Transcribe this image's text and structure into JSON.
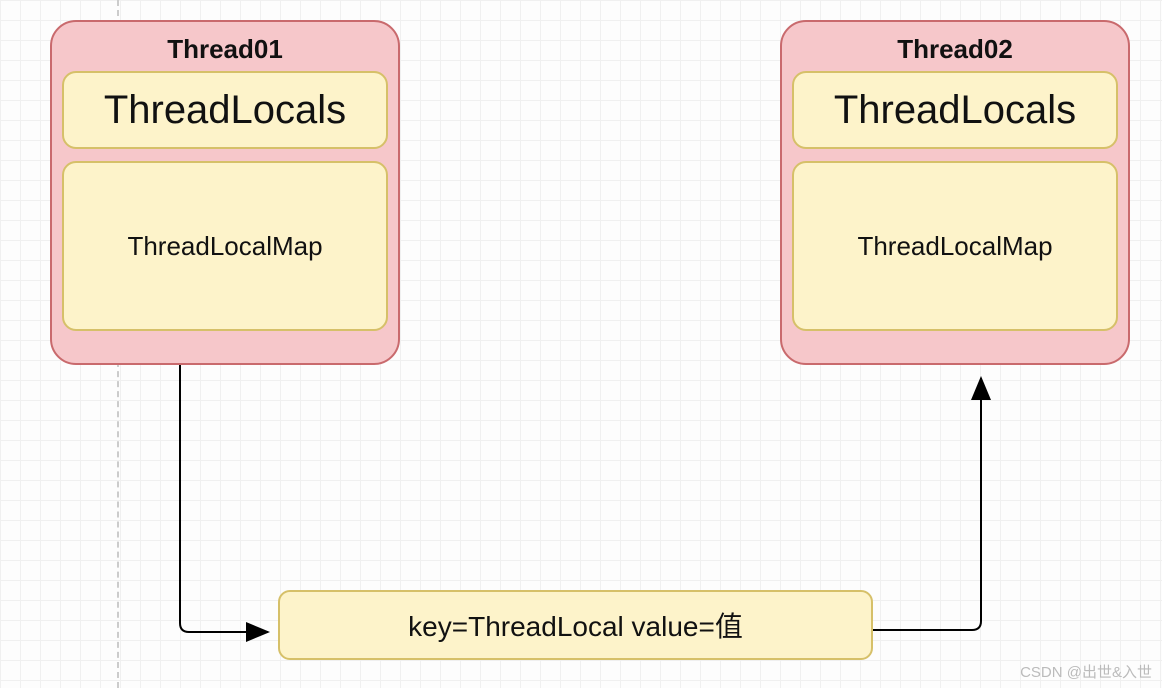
{
  "thread1": {
    "title": "Thread01",
    "locals": "ThreadLocals",
    "map": "ThreadLocalMap"
  },
  "thread2": {
    "title": "Thread02",
    "locals": "ThreadLocals",
    "map": "ThreadLocalMap"
  },
  "kv": "key=ThreadLocal value=值",
  "watermark": "CSDN @出世&入世"
}
